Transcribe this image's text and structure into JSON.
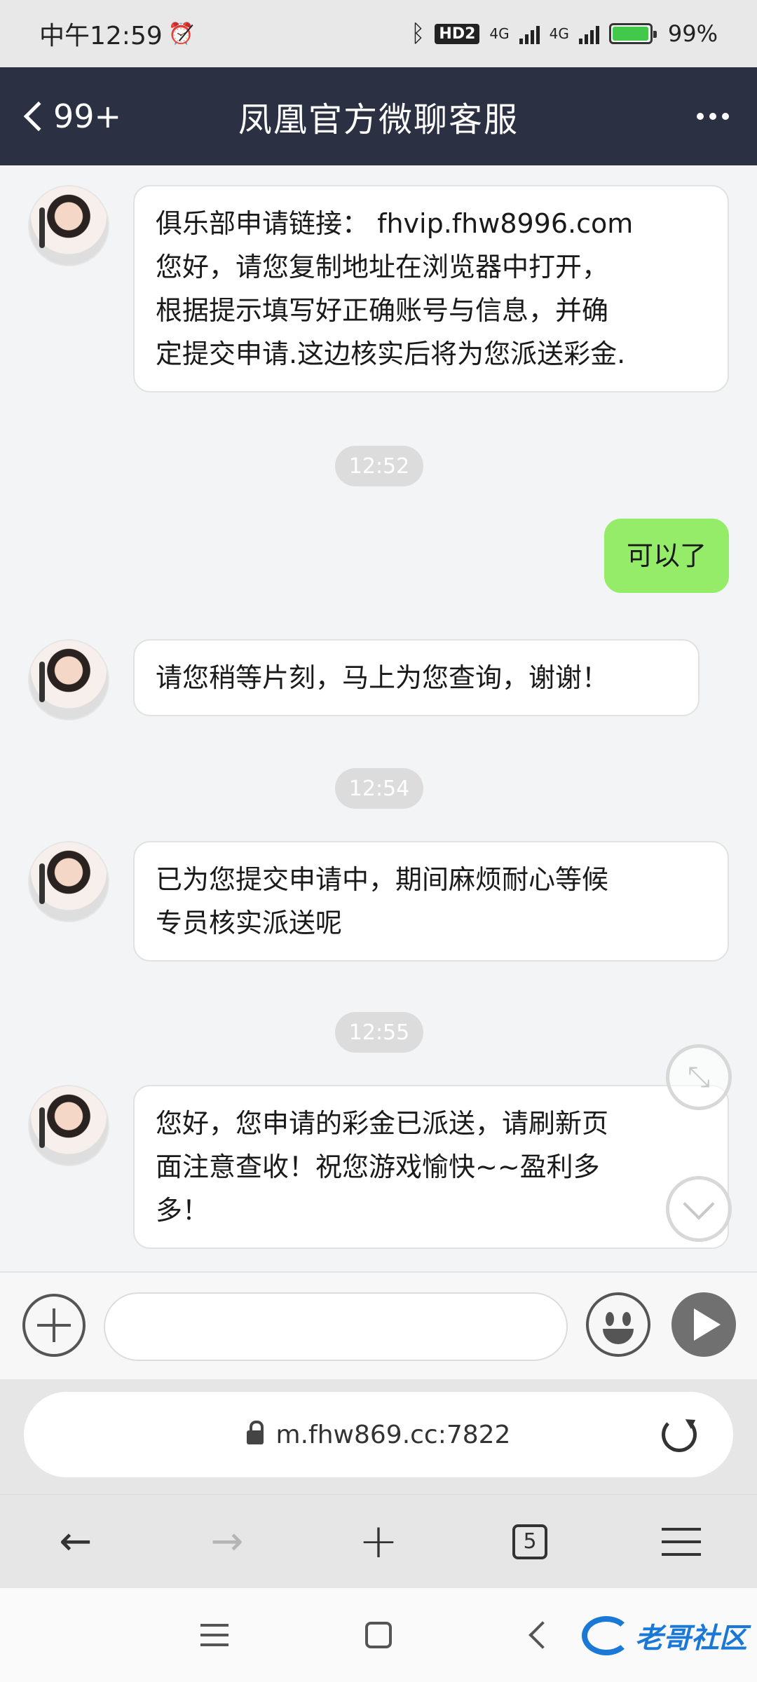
{
  "status_bar": {
    "time": "中午12:59",
    "alarm_icon": "alarm-off-icon",
    "hd_badge": "HD2",
    "network_1": "4G",
    "network_2": "4G",
    "battery_level": 99,
    "battery": "99%"
  },
  "header": {
    "back_label": "99+",
    "title": "凤凰官方微聊客服",
    "background_color": "#2b3142"
  },
  "messages": [
    {
      "type": "incoming",
      "text_lines": [
        "俱乐部申请链接： fhvip.fhw8996.com",
        "您好，请您复制地址在浏览器中打开，",
        "根据提示填写好正确账号与信息，并确",
        "定提交申请.这边核实后将为您派送彩金."
      ]
    },
    {
      "type": "time",
      "text": "12:52"
    },
    {
      "type": "outgoing",
      "text": "可以了"
    },
    {
      "type": "incoming",
      "text_lines": [
        "请您稍等片刻，马上为您查询，谢谢！"
      ]
    },
    {
      "type": "time",
      "text": "12:54"
    },
    {
      "type": "incoming",
      "text_lines": [
        "已为您提交申请中，期间麻烦耐心等候",
        "专员核实派送呢"
      ]
    },
    {
      "type": "time",
      "text": "12:55"
    },
    {
      "type": "incoming",
      "text_lines": [
        "您好，您申请的彩金已派送，请刷新页",
        "面注意查收！祝您游戏愉快~~盈利多",
        "多！"
      ]
    }
  ],
  "input_bar": {
    "placeholder": "",
    "value": ""
  },
  "browser": {
    "url": "m.fhw869.cc:7822",
    "tab_count": "5"
  },
  "watermark": {
    "text": "老哥社区"
  },
  "colors": {
    "outgoing_bubble": "#95ec69",
    "header": "#2b3142",
    "accent": "#1a78d6"
  }
}
